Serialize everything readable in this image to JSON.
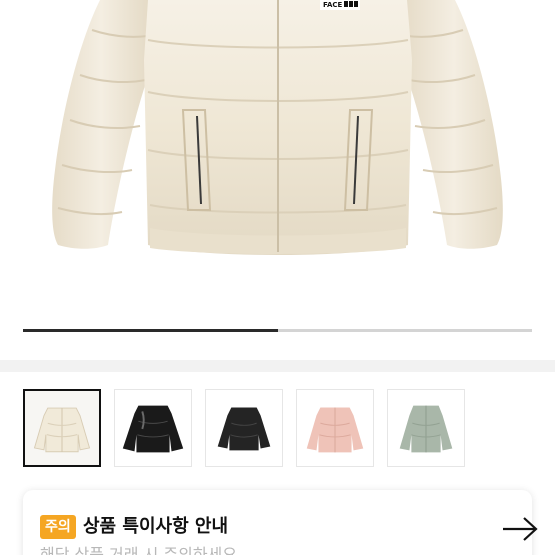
{
  "product": {
    "logo_text": "FACE",
    "carousel_progress": 0.5
  },
  "thumbnails": [
    {
      "color_name": "ivory",
      "hex": "#f1ead9",
      "selected": true
    },
    {
      "color_name": "black-glossy",
      "hex": "#1a1a1a",
      "selected": false
    },
    {
      "color_name": "black",
      "hex": "#242424",
      "selected": false
    },
    {
      "color_name": "pink",
      "hex": "#efc3b8",
      "selected": false
    },
    {
      "color_name": "sage",
      "hex": "#a9b7a9",
      "selected": false
    }
  ],
  "notice": {
    "badge": "주의",
    "title": "상품 특이사항 안내",
    "subtitle": "해당 상품 거래 시 주의하세요",
    "arrow_icon": "arrow-right-icon"
  },
  "colors": {
    "badge": "#f5a623",
    "jacket": "#f1ead9"
  }
}
